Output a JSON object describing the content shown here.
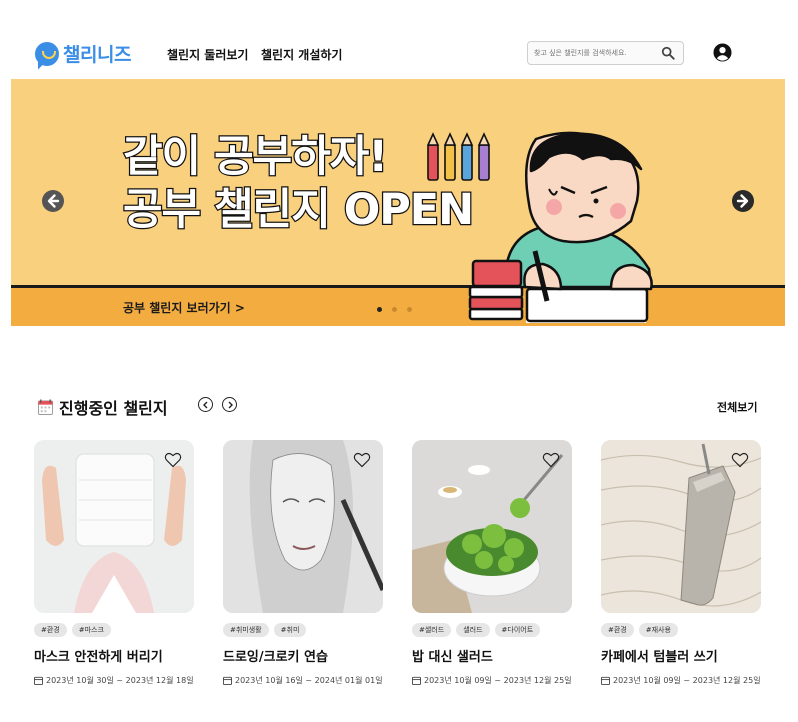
{
  "header": {
    "logo_text": "챌리니즈",
    "nav": [
      "챌린지 둘러보기",
      "챌린지 개설하기"
    ],
    "search_placeholder": "찾고 싶은 챌린지를 검색하세요."
  },
  "banner": {
    "title_line1": "같이 공부하자!",
    "title_line2": "공부 챌린지 OPEN",
    "link": "공부 챌린지 보러가기 >",
    "slides_total": 3,
    "active_slide": 1
  },
  "section": {
    "title": "진행중인 챌린지",
    "view_all": "전체보기"
  },
  "cards": [
    {
      "title": "마스크 안전하게 버리기",
      "tags": [
        "#환경",
        "#마스크"
      ],
      "date": "2023년 10월 30일 ~ 2023년 12월 18일"
    },
    {
      "title": "드로잉/크로키 연습",
      "tags": [
        "#취미생활",
        "#취미"
      ],
      "date": "2023년 10월 16일 ~ 2024년 01월 01일"
    },
    {
      "title": "밥 대신 샐러드",
      "tags": [
        "#샐러드",
        "샐러드",
        "#다이어트"
      ],
      "date": "2023년 10월 09일 ~ 2023년 12월 25일"
    },
    {
      "title": "카페에서 텀블러 쓰기",
      "tags": [
        "#환경",
        "#재사용"
      ],
      "date": "2023년 10월 09일 ~ 2023년 12월 25일"
    }
  ],
  "colors": {
    "brand": "#3a8ee6",
    "banner_bg": "#f9d07e",
    "banner_stripe": "#f3ac40"
  }
}
